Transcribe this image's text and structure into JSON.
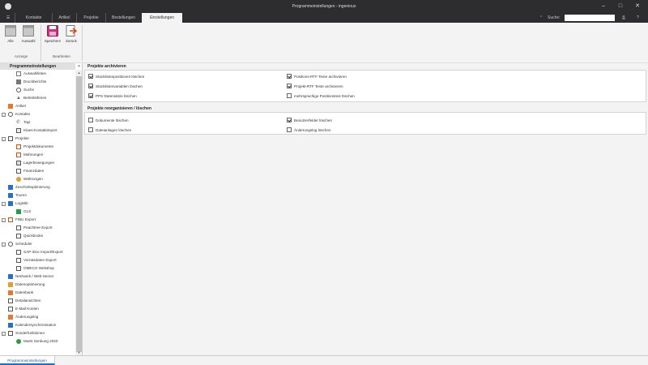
{
  "window": {
    "title": "Programmeinstellungen - ingenious",
    "minimize_icon": "minimize-icon",
    "maximize_icon": "maximize-icon",
    "close_icon": "close-icon"
  },
  "menu": {
    "tabs": [
      {
        "label": "Kontakte"
      },
      {
        "label": "Artikel"
      },
      {
        "label": "Projekte"
      },
      {
        "label": "Bestellungen"
      },
      {
        "label": "Einstellungen"
      }
    ],
    "search_label": "Suche:",
    "search_value": "",
    "help": "?"
  },
  "ribbon": {
    "buttons": [
      {
        "label": "Alle"
      },
      {
        "label": "Auswahl"
      },
      {
        "label": "Speichern"
      },
      {
        "label": "Zurück"
      }
    ],
    "groups": [
      {
        "label": "Anzeige"
      },
      {
        "label": "Bearbeiten"
      }
    ]
  },
  "sidebar": {
    "header": "Programmeinstellungen",
    "collapse": "«",
    "items": [
      {
        "label": "Auswahllisten",
        "icon": "list-icon"
      },
      {
        "label": "Druckberichte",
        "icon": "printer-icon"
      },
      {
        "label": "Suche",
        "icon": "search-icon"
      },
      {
        "label": "Betriebsferien",
        "icon": "vacation-icon"
      },
      {
        "label": "Artikel",
        "icon": "article-icon"
      },
      {
        "label": "Kontakte",
        "icon": "contacts-icon"
      },
      {
        "label": "Tapi",
        "icon": "phone-icon"
      },
      {
        "label": "Klaes-Kontaktimport",
        "icon": "import-icon"
      },
      {
        "label": "Projekte",
        "icon": "document-icon"
      },
      {
        "label": "Projektdokumente",
        "icon": "document-icon"
      },
      {
        "label": "Mahnungen",
        "icon": "reminder-icon"
      },
      {
        "label": "Lagerbewegungen",
        "icon": "warehouse-icon"
      },
      {
        "label": "Finanzdaten",
        "icon": "finance-icon"
      },
      {
        "label": "Währungen",
        "icon": "currency-icon"
      },
      {
        "label": "Zuschnittoptimierung",
        "icon": "cut-icon"
      },
      {
        "label": "Touren",
        "icon": "truck-icon"
      },
      {
        "label": "Logistik",
        "icon": "logistics-icon"
      },
      {
        "label": "GLS",
        "icon": "gls-icon"
      },
      {
        "label": "FIBU Export",
        "icon": "export-icon"
      },
      {
        "label": "Peachtree Export",
        "icon": "export-icon"
      },
      {
        "label": "Quickbooks",
        "icon": "book-icon"
      },
      {
        "label": "Scheduler",
        "icon": "clock-icon"
      },
      {
        "label": "SAP IDoc Import/Export",
        "icon": "sap-icon"
      },
      {
        "label": "Vorratsdaten Export",
        "icon": "export-icon"
      },
      {
        "label": "OMECO Webshop",
        "icon": "shop-icon"
      },
      {
        "label": "Netzwerk / Web-Server",
        "icon": "network-icon"
      },
      {
        "label": "Datenoptimierung",
        "icon": "optimize-icon"
      },
      {
        "label": "Datenbank",
        "icon": "database-icon"
      },
      {
        "label": "Detailansichten",
        "icon": "detail-icon"
      },
      {
        "label": "E-Mail Konten",
        "icon": "mail-icon"
      },
      {
        "label": "Änderungslog",
        "icon": "log-icon"
      },
      {
        "label": "Kalendersynchronisation",
        "icon": "calendar-icon"
      },
      {
        "label": "Sonderfunktionen",
        "icon": "special-icon"
      },
      {
        "label": "MwSt Senkung 2020",
        "icon": "tax-icon"
      }
    ]
  },
  "sections": [
    {
      "title": "Projekte archivieren",
      "options": [
        {
          "label": "Stücklistenpositionen löschen",
          "checked": true
        },
        {
          "label": "Stücklistenvariablen löschen",
          "checked": true
        },
        {
          "label": "PPS Datensätze löschen",
          "checked": true
        },
        {
          "label": "Positions-RTF Texte archivieren",
          "checked": true
        },
        {
          "label": "Projekt-RTF Texte archivieren",
          "checked": true
        },
        {
          "label": "mehrsprachige Positionstext löschen",
          "checked": false
        }
      ]
    },
    {
      "title": "Projekte reorganisieren / löschen",
      "options": [
        {
          "label": "Dokumente löschen",
          "checked": false
        },
        {
          "label": "Dateianlagen löschen",
          "checked": false
        },
        {
          "label": "Benutzerfelder löschen",
          "checked": true
        },
        {
          "label": "Änderungslog löschen",
          "checked": false
        }
      ]
    }
  ],
  "status": {
    "tab": "Programmeinstellungen"
  }
}
